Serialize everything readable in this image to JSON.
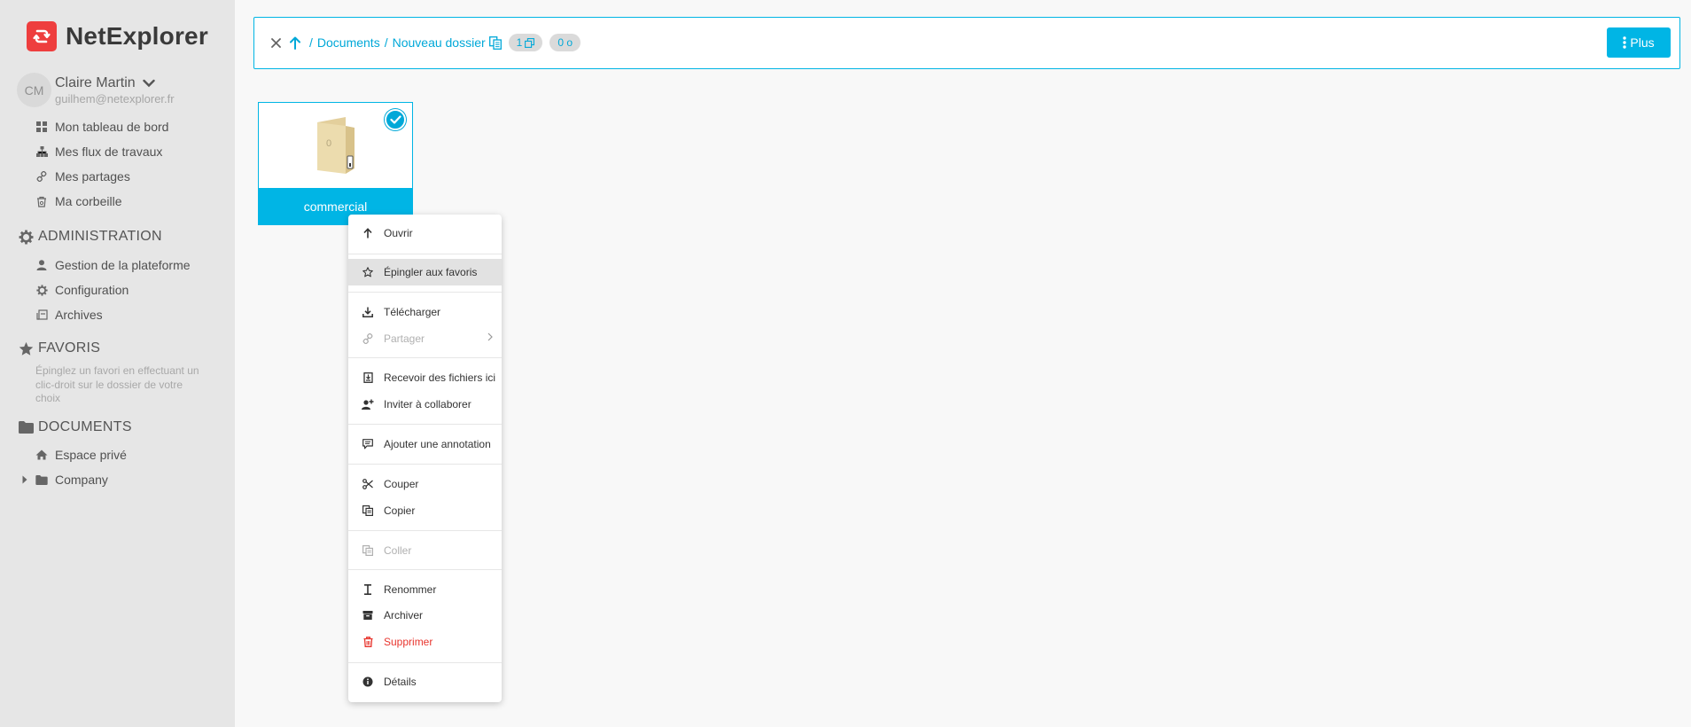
{
  "app": {
    "name": "NetExplorer",
    "brand_color": "#ee3e3e",
    "accent_color": "#00b5e5"
  },
  "user": {
    "initials": "CM",
    "name": "Claire Martin",
    "email": "guilhem@netexplorer.fr"
  },
  "sidebar": {
    "personal": [
      {
        "label": "Mon tableau de bord",
        "icon": "dashboard-icon"
      },
      {
        "label": "Mes flux de travaux",
        "icon": "workflow-icon"
      },
      {
        "label": "Mes partages",
        "icon": "link-icon"
      },
      {
        "label": "Ma corbeille",
        "icon": "trash-icon"
      }
    ],
    "admin": {
      "title": "ADMINISTRATION",
      "items": [
        {
          "label": "Gestion de la plateforme",
          "icon": "user-icon"
        },
        {
          "label": "Configuration",
          "icon": "gear-icon"
        },
        {
          "label": "Archives",
          "icon": "archive-icon"
        }
      ]
    },
    "favorites": {
      "title": "FAVORIS",
      "hint": "Épinglez un favori en effectuant un clic-droit sur le dossier de votre choix"
    },
    "documents": {
      "title": "DOCUMENTS",
      "items": [
        {
          "label": "Espace privé",
          "icon": "home-icon"
        },
        {
          "label": "Company",
          "icon": "folder-icon"
        }
      ]
    }
  },
  "toolbar": {
    "breadcrumb": [
      "Documents",
      "Nouveau dossier"
    ],
    "breadcrumb_sep": "/",
    "selected_count": "1",
    "selected_size": "0 o",
    "more_label": "Plus"
  },
  "folder": {
    "name": "commercial",
    "count": "0",
    "selected": true
  },
  "context_menu": {
    "open": "Ouvrir",
    "pin": "Épingler aux favoris",
    "download": "Télécharger",
    "share": "Partager",
    "receive": "Recevoir des fichiers ici",
    "invite": "Inviter à collaborer",
    "annotate": "Ajouter une annotation",
    "cut": "Couper",
    "copy": "Copier",
    "paste": "Coller",
    "rename": "Renommer",
    "archive": "Archiver",
    "delete": "Supprimer",
    "details": "Détails"
  }
}
